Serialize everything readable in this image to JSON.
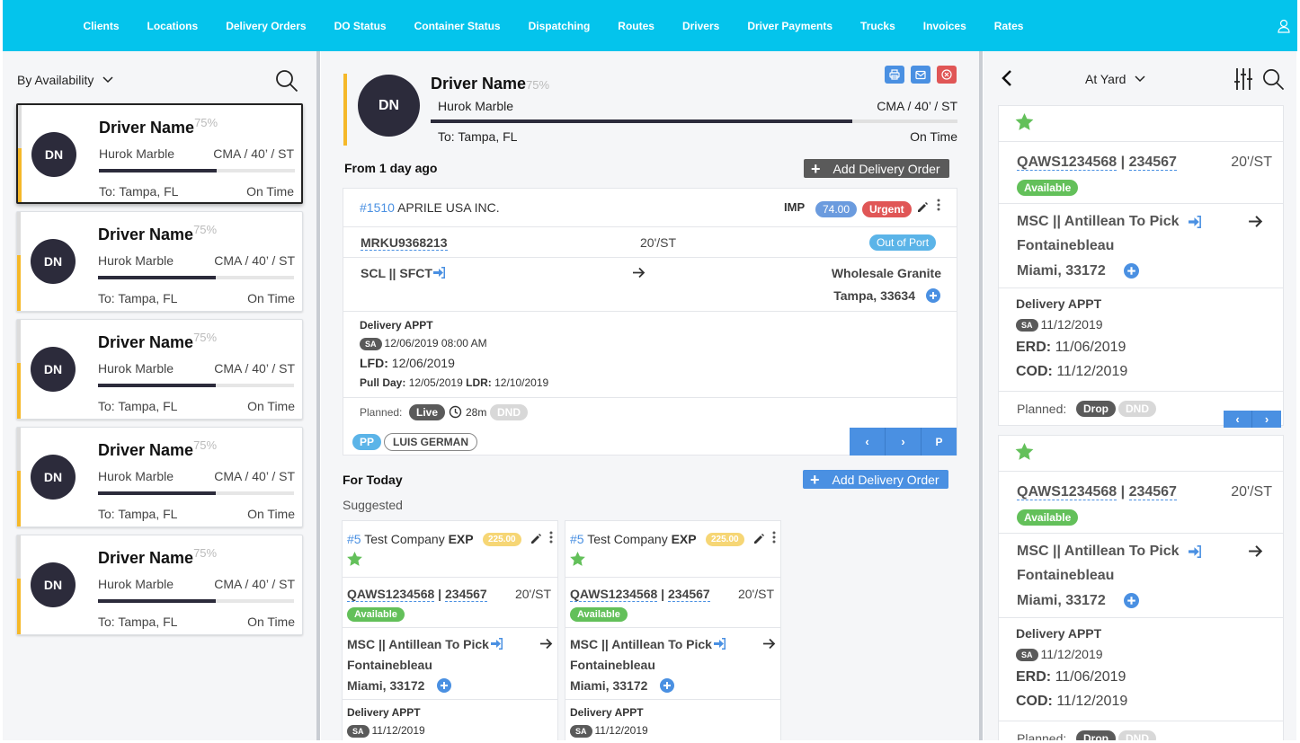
{
  "nav": {
    "items": [
      "Clients",
      "Locations",
      "Delivery Orders",
      "DO Status",
      "Container Status",
      "Dispatching",
      "Routes",
      "Drivers",
      "Driver Payments",
      "Trucks",
      "Invoices",
      "Rates"
    ]
  },
  "left": {
    "filter_label": "By Availability",
    "drivers": [
      {
        "initials": "DN",
        "name": "Driver Name",
        "pct": "75%",
        "company": "Hurok Marble",
        "type": "CMA / 40’ / ST",
        "to": "To: Tampa, FL",
        "status": "On Time",
        "progress": 0.6
      },
      {
        "initials": "DN",
        "name": "Driver Name",
        "pct": "75%",
        "company": "Hurok Marble",
        "type": "CMA / 40’ / ST",
        "to": "To: Tampa, FL",
        "status": "On Time",
        "progress": 0.6
      },
      {
        "initials": "DN",
        "name": "Driver Name",
        "pct": "75%",
        "company": "Hurok Marble",
        "type": "CMA / 40’ / ST",
        "to": "To: Tampa, FL",
        "status": "On Time",
        "progress": 0.6
      },
      {
        "initials": "DN",
        "name": "Driver Name",
        "pct": "75%",
        "company": "Hurok Marble",
        "type": "CMA / 40’ / ST",
        "to": "To: Tampa, FL",
        "status": "On Time",
        "progress": 0.6
      },
      {
        "initials": "DN",
        "name": "Driver Name",
        "pct": "75%",
        "company": "Hurok Marble",
        "type": "CMA / 40’ / ST",
        "to": "To: Tampa, FL",
        "status": "On Time",
        "progress": 0.6
      }
    ]
  },
  "main": {
    "driver": {
      "initials": "DN",
      "name": "Driver Name",
      "pct": "75%",
      "company": "Hurok Marble",
      "type": "CMA / 40’ / ST",
      "to": "To: Tampa, FL",
      "status": "On Time",
      "progress": 0.8
    },
    "section1_title": "From 1 day ago",
    "add_label": "Add Delivery Order",
    "order": {
      "number": "#1510",
      "company": "APRILE USA INC.",
      "kind": "IMP",
      "amount": "74.00",
      "priority": "Urgent",
      "container": "MRKU9368213",
      "size": "20'/ST",
      "port_status": "Out of Port",
      "origin": "SCL || SFCT",
      "dest_name": "Wholesale Granite",
      "dest_city": "Tampa, 33634",
      "appt_label": "Delivery APPT",
      "appt_badge": "SA",
      "appt_date": "12/06/2019 08:00 AM",
      "lfd_label": "LFD:",
      "lfd": "12/06/2019",
      "pull_label": "Pull Day:",
      "pull": "12/05/2019",
      "ldr_label": "LDR:",
      "ldr": "12/10/2019",
      "planned_label": "Planned:",
      "planned": "Live",
      "time": "28m",
      "dnd": "DND",
      "pp": "PP",
      "driver_tag": "LUIS GERMAN",
      "p_btn": "P"
    },
    "section2_title": "For Today",
    "suggested": "Suggested",
    "suggested_cards": [
      {
        "number": "#5",
        "company": "Test Company",
        "kind": "EXP",
        "amount": "225.00",
        "container": "QAWS1234568",
        "ref": "234567",
        "size": "20'/ST",
        "avail": "Available",
        "origin": "MSC || Antillean To Pick",
        "dest_name": "Fontainebleau",
        "dest_city": "Miami, 33172",
        "appt_label": "Delivery APPT",
        "appt_badge": "SA",
        "appt_date": "11/12/2019"
      },
      {
        "number": "#5",
        "company": "Test Company",
        "kind": "EXP",
        "amount": "225.00",
        "container": "QAWS1234568",
        "ref": "234567",
        "size": "20'/ST",
        "avail": "Available",
        "origin": "MSC || Antillean To Pick",
        "dest_name": "Fontainebleau",
        "dest_city": "Miami, 33172",
        "appt_label": "Delivery APPT",
        "appt_badge": "SA",
        "appt_date": "11/12/2019"
      }
    ]
  },
  "right": {
    "filter_label": "At Yard",
    "cards": [
      {
        "container": "QAWS1234568",
        "ref": "234567",
        "size": "20'/ST",
        "avail": "Available",
        "origin": "MSC || Antillean To Pick",
        "dest_name": "Fontainebleau",
        "dest_city": "Miami, 33172",
        "appt_label": "Delivery APPT",
        "appt_badge": "SA",
        "appt_date": "11/12/2019",
        "erd_label": "ERD:",
        "erd": "11/06/2019",
        "cod_label": "COD:",
        "cod": "11/12/2019",
        "planned_label": "Planned:",
        "planned": "Drop",
        "dnd": "DND"
      },
      {
        "container": "QAWS1234568",
        "ref": "234567",
        "size": "20'/ST",
        "avail": "Available",
        "origin": "MSC || Antillean To Pick",
        "dest_name": "Fontainebleau",
        "dest_city": "Miami, 33172",
        "appt_label": "Delivery APPT",
        "appt_badge": "SA",
        "appt_date": "11/12/2019",
        "erd_label": "ERD:",
        "erd": "11/06/2019",
        "cod_label": "COD:",
        "cod": "11/12/2019",
        "planned_label": "Planned:",
        "planned": "Drop",
        "dnd": "DND"
      }
    ]
  },
  "colors": {
    "nav": "#04c4ec",
    "accent": "#4a90e2",
    "urgent": "#e05656",
    "available": "#63c05a",
    "yellow_bar": "#f5b829",
    "amount_yellow": "#f6d675",
    "avatar": "#2c2b3b"
  }
}
